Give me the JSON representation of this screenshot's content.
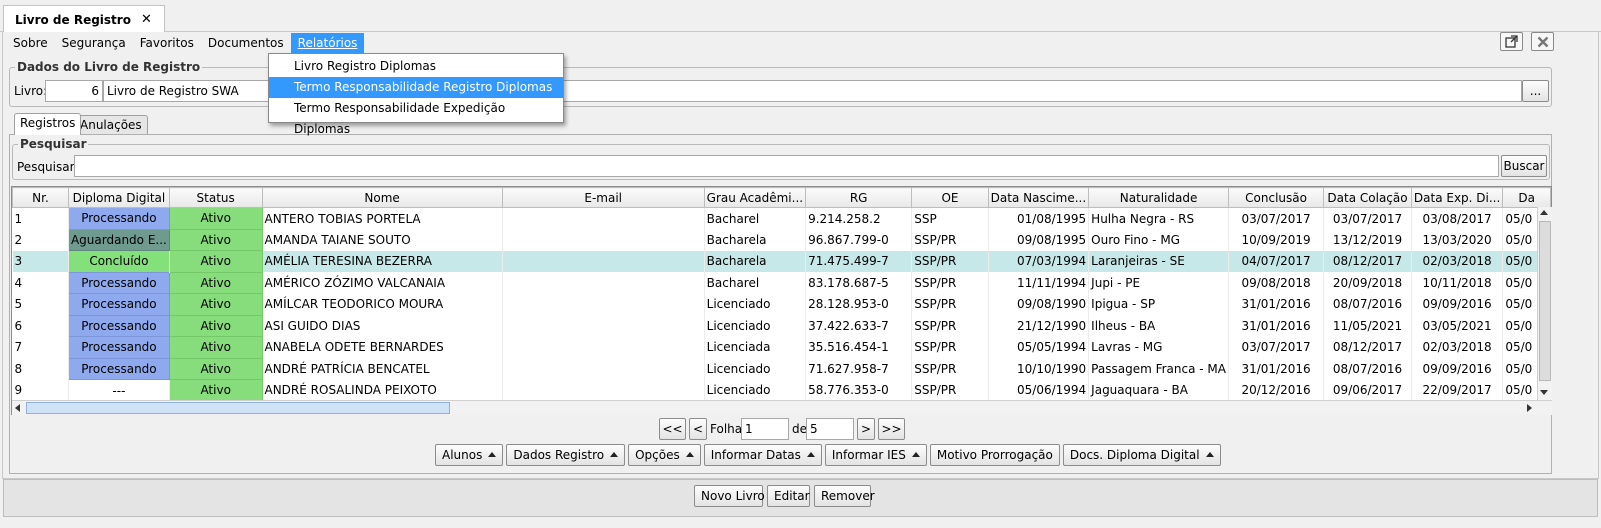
{
  "window": {
    "tab_title": "Livro de Registro",
    "tab_close": "✕"
  },
  "menu": {
    "items": [
      {
        "label": "Sobre",
        "active": false
      },
      {
        "label": "Segurança",
        "active": false
      },
      {
        "label": "Favoritos",
        "active": false
      },
      {
        "label": "Documentos",
        "active": false
      },
      {
        "label": "Relatórios",
        "active": true
      }
    ]
  },
  "dropdown": {
    "items": [
      {
        "label": "Livro Registro Diplomas",
        "highlighted": false
      },
      {
        "label": "Termo Responsabilidade Registro Diplomas",
        "highlighted": true
      },
      {
        "label": "Termo Responsabilidade Expedição Diplomas",
        "highlighted": false
      }
    ]
  },
  "dados": {
    "group_title": "Dados do Livro de Registro",
    "livro_label": "Livro:",
    "livro_num": "6",
    "livro_nome": "Livro de Registro SWA",
    "browse_label": "..."
  },
  "tabs": [
    "Registros",
    "Anulações"
  ],
  "pesquisar": {
    "group_title": "Pesquisar",
    "label": "Pesquisar:",
    "value": "",
    "button": "Buscar"
  },
  "table": {
    "columns": [
      "Nr.",
      "Diploma Digital",
      "Status",
      "Nome",
      "E-mail",
      "Grau Acadêmi...",
      "RG",
      "OE",
      "Data Nascime...",
      "Naturalidade",
      "Conclusão",
      "Data Colação",
      "Data Exp. Di...",
      "Da"
    ],
    "rows": [
      {
        "nr": "1",
        "diploma": "Processando",
        "diploma_kind": "proc",
        "status": "Ativo",
        "nome": "ANTERO TOBIAS PORTELA",
        "email": "",
        "grau": "Bacharel",
        "rg": "9.214.258.2",
        "oe": "SSP",
        "nasc": "01/08/1995",
        "nat": "Hulha Negra - RS",
        "conc": "03/07/2017",
        "col": "03/07/2017",
        "exp": "03/08/2017",
        "da": "05/0",
        "selected": false
      },
      {
        "nr": "2",
        "diploma": "Aguardando E...",
        "diploma_kind": "agu",
        "status": "Ativo",
        "nome": "AMANDA TAIANE SOUTO",
        "email": "",
        "grau": "Bacharela",
        "rg": "96.867.799-0",
        "oe": "SSP/PR",
        "nasc": "09/08/1995",
        "nat": "Ouro Fino - MG",
        "conc": "10/09/2019",
        "col": "13/12/2019",
        "exp": "13/03/2020",
        "da": "05/0",
        "selected": false
      },
      {
        "nr": "3",
        "diploma": "Concluído",
        "diploma_kind": "conc",
        "status": "Ativo",
        "nome": "AMÉLIA TERESINA BEZERRA",
        "email": "",
        "grau": "Bacharela",
        "rg": "71.475.499-7",
        "oe": "SSP/PR",
        "nasc": "07/03/1994",
        "nat": "Laranjeiras - SE",
        "conc": "04/07/2017",
        "col": "08/12/2017",
        "exp": "02/03/2018",
        "da": "05/0",
        "selected": true
      },
      {
        "nr": "4",
        "diploma": "Processando",
        "diploma_kind": "proc",
        "status": "Ativo",
        "nome": "AMÉRICO ZÓZIMO VALCANAIA",
        "email": "",
        "grau": "Bacharel",
        "rg": "83.178.687-5",
        "oe": "SSP/PR",
        "nasc": "11/11/1994",
        "nat": "Jupi - PE",
        "conc": "09/08/2018",
        "col": "20/09/2018",
        "exp": "10/11/2018",
        "da": "05/0",
        "selected": false
      },
      {
        "nr": "5",
        "diploma": "Processando",
        "diploma_kind": "proc",
        "status": "Ativo",
        "nome": "AMÍLCAR TEODORICO MOURA",
        "email": "",
        "grau": "Licenciado",
        "rg": "28.128.953-0",
        "oe": "SSP/PR",
        "nasc": "09/08/1990",
        "nat": "Ipigua - SP",
        "conc": "31/01/2016",
        "col": "08/07/2016",
        "exp": "09/09/2016",
        "da": "05/0",
        "selected": false
      },
      {
        "nr": "6",
        "diploma": "Processando",
        "diploma_kind": "proc",
        "status": "Ativo",
        "nome": "ASI GUIDO DIAS",
        "email": "",
        "grau": "Licenciado",
        "rg": "37.422.633-7",
        "oe": "SSP/PR",
        "nasc": "21/12/1990",
        "nat": "Ilheus - BA",
        "conc": "31/01/2016",
        "col": "11/05/2021",
        "exp": "03/05/2021",
        "da": "05/0",
        "selected": false
      },
      {
        "nr": "7",
        "diploma": "Processando",
        "diploma_kind": "proc",
        "status": "Ativo",
        "nome": "ANABELA ODETE BERNARDES",
        "email": "",
        "grau": "Licenciada",
        "rg": "35.516.454-1",
        "oe": "SSP/PR",
        "nasc": "05/05/1994",
        "nat": "Lavras - MG",
        "conc": "03/07/2017",
        "col": "08/12/2017",
        "exp": "02/03/2018",
        "da": "05/0",
        "selected": false
      },
      {
        "nr": "8",
        "diploma": "Processando",
        "diploma_kind": "proc",
        "status": "Ativo",
        "nome": "ANDRÉ PATRÍCIA BENCATEL",
        "email": "",
        "grau": "Licenciado",
        "rg": "71.627.958-7",
        "oe": "SSP/PR",
        "nasc": "10/10/1990",
        "nat": "Passagem Franca - MA",
        "conc": "31/01/2016",
        "col": "08/07/2016",
        "exp": "09/09/2016",
        "da": "05/0",
        "selected": false
      },
      {
        "nr": "9",
        "diploma": "---",
        "diploma_kind": "none",
        "status": "Ativo",
        "nome": "ANDRÉ ROSALINDA PEIXOTO",
        "email": "",
        "grau": "Licenciado",
        "rg": "58.776.353-0",
        "oe": "SSP/PR",
        "nasc": "05/06/1994",
        "nat": "Jaguaquara - BA",
        "conc": "20/12/2016",
        "col": "09/06/2017",
        "exp": "22/09/2017",
        "da": "05/0",
        "selected": false
      }
    ]
  },
  "pager": {
    "first": "<<",
    "prev": "<",
    "folha_label": "Folha",
    "folha_value": "1",
    "de_label": "de",
    "total_value": "5",
    "next": ">",
    "last": ">>"
  },
  "actions": [
    "Alunos",
    "Dados Registro",
    "Opções",
    "Informar Datas",
    "Informar IES",
    "Motivo Prorrogação",
    "Docs. Diploma Digital"
  ],
  "actions_with_arrow": [
    true,
    true,
    true,
    true,
    true,
    false,
    true
  ],
  "footer": [
    "Novo Livro",
    "Editar",
    "Remover"
  ],
  "colors": {
    "accent": "#3399ff",
    "processando": "#8fa9ee",
    "aguardando": "#6f9b8f",
    "concluido": "#84e07a",
    "ativo": "#87dc7c",
    "selected_row": "#c7e8e8"
  }
}
